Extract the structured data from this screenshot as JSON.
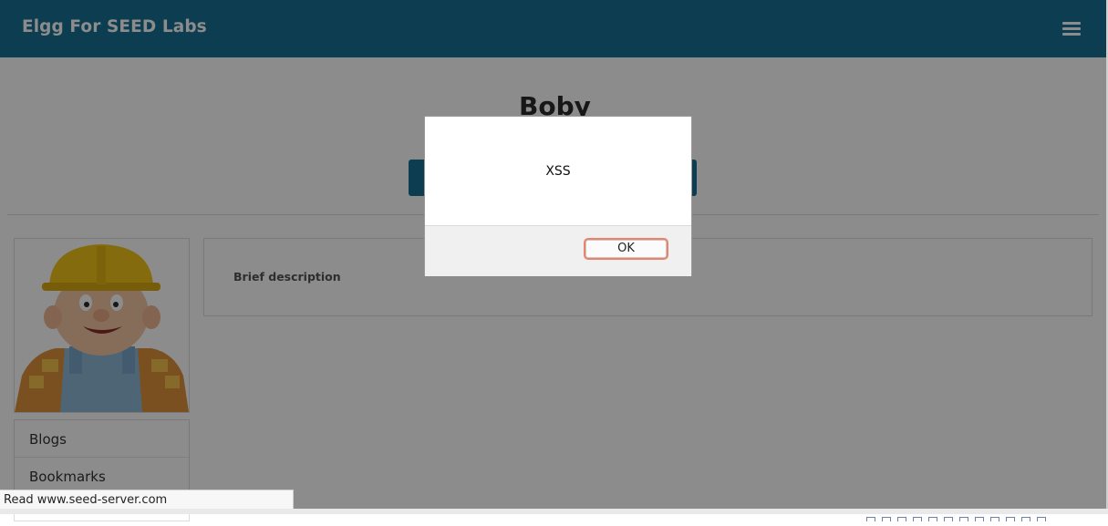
{
  "site": {
    "title": "Elgg For SEED Labs"
  },
  "profile": {
    "name": "Boby",
    "brief_description_label": "Brief description"
  },
  "menu": {
    "items": [
      {
        "label": "Blogs"
      },
      {
        "label": "Bookmarks"
      }
    ]
  },
  "dialog": {
    "message": "XSS",
    "ok_label": "OK"
  },
  "status": {
    "text": "Read www.seed-server.com"
  },
  "colors": {
    "brand": "#167093",
    "backdrop": "rgba(0,0,0,0.45)",
    "ok_focus_ring": "#e8846a"
  },
  "icons": {
    "menu": "hamburger-menu-icon",
    "avatar": "user-avatar-image"
  }
}
